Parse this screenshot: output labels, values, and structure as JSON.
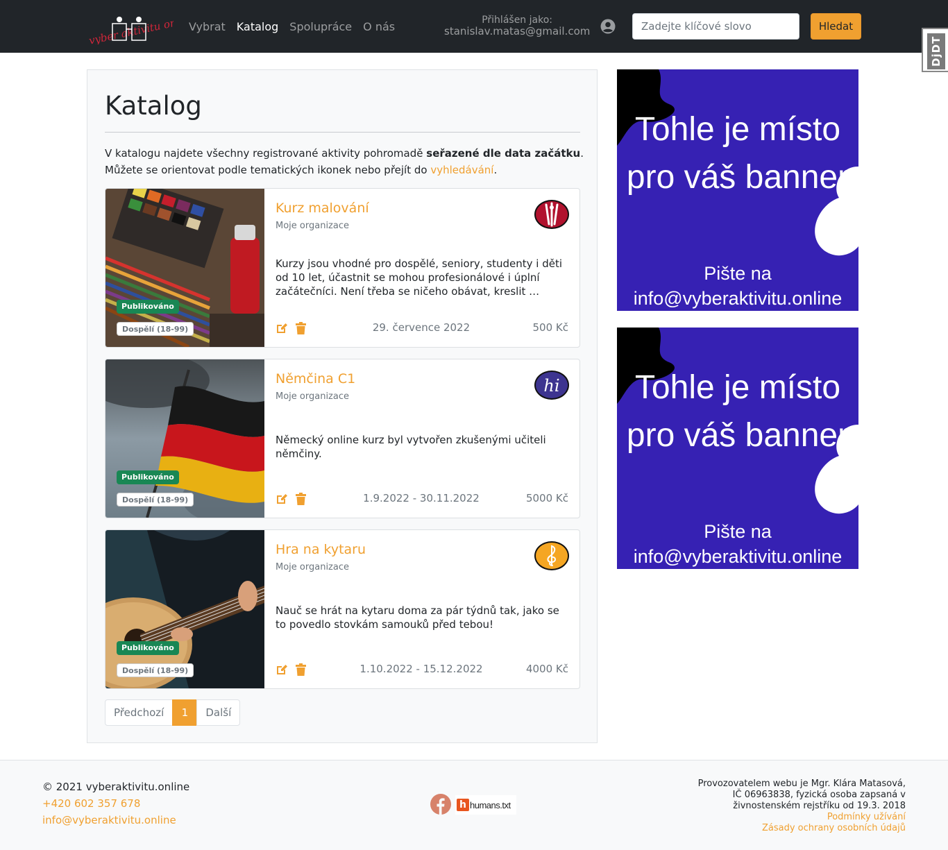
{
  "navbar": {
    "logo_text": "vyber aktivitu online",
    "links": [
      {
        "label": "Vybrat",
        "active": false
      },
      {
        "label": "Katalog",
        "active": true
      },
      {
        "label": "Spolupráce",
        "active": false
      },
      {
        "label": "O nás",
        "active": false
      }
    ],
    "login_label": "Přihlášen jako:",
    "login_email": "stanislav.matas@gmail.com",
    "user_icon": "user-circle-icon",
    "search_placeholder": "Zadejte klíčové slovo",
    "search_button": "Hledat",
    "accent_color": "#f0a030",
    "debug_toolbar": "DjDT"
  },
  "main": {
    "title": "Katalog",
    "intro_line1_pre": "V katalogu najdete všechny registrované aktivity pohromadě ",
    "intro_line1_bold": "seřazené dle data začátku",
    "intro_line1_post": ".",
    "intro_line2_pre": "Můžete se orientovat podle tematických ikonek nebo přejít do ",
    "intro_line2_link": "vyhledávání",
    "intro_line2_post": ".",
    "activities": [
      {
        "title": "Kurz malování",
        "organization": "Moje organizace",
        "description": "Kurzy jsou vhodné pro dospělé, seniory, studenty i děti od 10 let, účastnit se mohou profesionálové i úplní začátečníci. Není třeba se ničeho obávat, kreslit …",
        "date": "29. července 2022",
        "price": "500 Kč",
        "status_badge": "Publikováno",
        "age_badge": "Dospělí (18-99)",
        "category_icon": "art-brushes-icon",
        "icon_color": "#b1122e"
      },
      {
        "title": "Němčina C1",
        "organization": "Moje organizace",
        "description": "Německý online kurz byl vytvořen zkušenými učiteli němčiny.",
        "date": "1.9.2022 - 30.11.2022",
        "price": "5000 Kč",
        "status_badge": "Publikováno",
        "age_badge": "Dospělí (18-99)",
        "category_icon": "language-hi-icon",
        "icon_text": "hi",
        "icon_color": "#3d3490"
      },
      {
        "title": "Hra na kytaru",
        "organization": "Moje organizace",
        "description": "Nauč se hrát na kytaru doma za pár týdnů tak, jako se to povedlo stovkám samouků před tebou!",
        "date": "1.10.2022 - 15.12.2022",
        "price": "4000 Kč",
        "status_badge": "Publikováno",
        "age_badge": "Dospělí (18-99)",
        "category_icon": "music-treble-clef-icon",
        "icon_color": "#f5a623"
      }
    ],
    "pagination": {
      "prev": "Předchozí",
      "current": "1",
      "next": "Další"
    }
  },
  "banners": [
    {
      "headline": "Tohle je místo pro váš banner",
      "line1": "Pište na",
      "line2": "info@vyberaktivitu.online",
      "color": "#3621b3"
    },
    {
      "headline": "Tohle je místo pro váš banner",
      "line1": "Pište na",
      "line2": "info@vyberaktivitu.online",
      "color": "#3621b3"
    }
  ],
  "footer": {
    "copyright": "© 2021 vyberaktivitu.online",
    "phone": "+420 602 357 678",
    "email": "info@vyberaktivitu.online",
    "facebook_icon": "facebook-icon",
    "humans_txt": "humans.txt",
    "operator_line1": "Provozovatelem webu je Mgr. Klára Matasová,",
    "operator_line2": "IČ 06963838, fyzická osoba zapsaná v",
    "operator_line3": "živnostenském rejstříku od 19.3. 2018",
    "terms_link": "Podmínky užívání",
    "privacy_link": "Zásady ochrany osobních údajů"
  }
}
